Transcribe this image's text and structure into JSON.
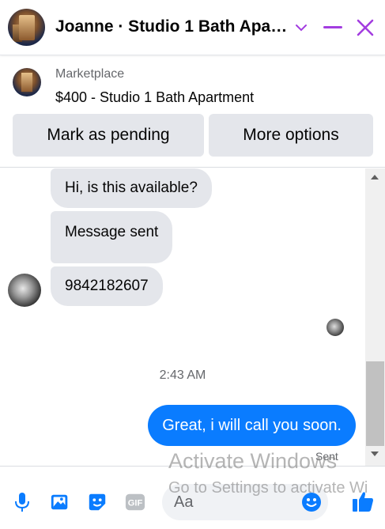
{
  "header": {
    "title": "Joanne · Studio 1 Bath Apa…",
    "chevron_icon": "chevron-down-icon",
    "minimize_icon": "minimize-icon",
    "close_icon": "close-icon",
    "accent": "#a33de0"
  },
  "listing": {
    "label": "Marketplace",
    "title": "$400 - Studio 1 Bath Apartment",
    "buttons": [
      "Mark as pending",
      "More options"
    ]
  },
  "messages": [
    {
      "from": "them",
      "text": "Hi, is this available?"
    },
    {
      "from": "them",
      "text": "Message sent"
    },
    {
      "from": "them",
      "text": "9842182607"
    }
  ],
  "timestamp": "2:43 AM",
  "my_message": {
    "text": "Great, i will call you soon.",
    "status": "Sent",
    "color": "#0a7cff"
  },
  "composer": {
    "placeholder": "Aa",
    "icons": [
      "microphone-icon",
      "photo-icon",
      "sticker-icon",
      "gif-icon",
      "emoji-icon",
      "like-icon"
    ]
  },
  "watermark": {
    "line1": "Activate Windows",
    "line2": "Go to Settings to activate Wi"
  }
}
